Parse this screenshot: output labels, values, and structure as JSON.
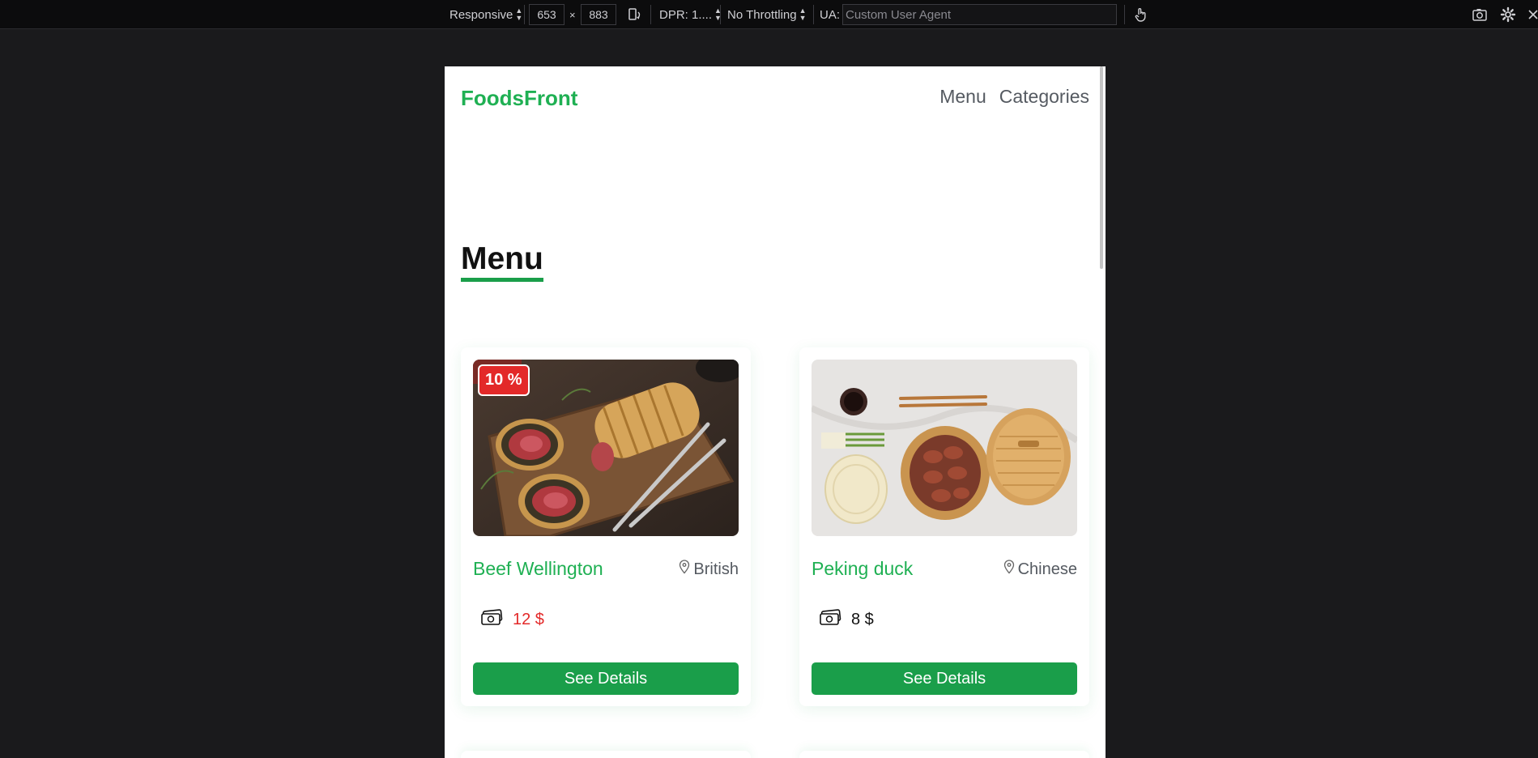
{
  "devtools": {
    "device": "Responsive",
    "width": "653",
    "times": "×",
    "height": "883",
    "dpr": "DPR: 1....",
    "throttling": "No Throttling",
    "ua_label": "UA:",
    "ua_placeholder": "Custom User Agent",
    "icons": [
      "rotate-device-icon",
      "touch-hand-icon",
      "screenshot-camera-icon",
      "settings-gear-icon",
      "close-icon"
    ]
  },
  "navbar": {
    "brand": "FoodsFront",
    "links": [
      "Menu",
      "Categories"
    ]
  },
  "page": {
    "heading": "Menu"
  },
  "colors": {
    "brand_green": "#1fb053",
    "button_green": "#1a9e4a",
    "sale_red": "#e32929",
    "devtools_bg": "#0c0c0d"
  },
  "menu_items": [
    {
      "name": "Beef Wellington",
      "cuisine": "British",
      "price": "12 $",
      "discount_badge": "10 %",
      "on_sale": true,
      "button": "See Details"
    },
    {
      "name": "Peking duck",
      "cuisine": "Chinese",
      "price": "8 $",
      "on_sale": false,
      "button": "See Details"
    }
  ]
}
